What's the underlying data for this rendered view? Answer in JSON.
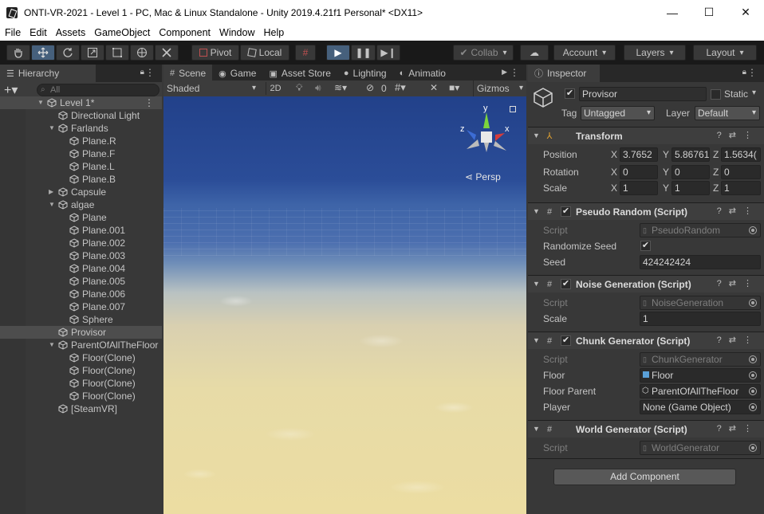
{
  "window": {
    "title": "ONTI-VR-2021 - Level 1 - PC, Mac & Linux Standalone - Unity 2019.4.21f1 Personal* <DX11>",
    "minimize": "—",
    "maximize": "☐",
    "close": "✕"
  },
  "menu": [
    "File",
    "Edit",
    "Assets",
    "GameObject",
    "Component",
    "Window",
    "Help"
  ],
  "toolbar": {
    "pivot": "Pivot",
    "local": "Local",
    "collab": "Collab",
    "account": "Account",
    "layers": "Layers",
    "layout": "Layout"
  },
  "hierarchy": {
    "tab": "Hierarchy",
    "search_placeholder": "All",
    "items": [
      {
        "label": "Level 1*",
        "depth": 0,
        "arrow": "▼",
        "type": "scene"
      },
      {
        "label": "Directional Light",
        "depth": 1,
        "arrow": "",
        "type": "object"
      },
      {
        "label": "Farlands",
        "depth": 1,
        "arrow": "▼",
        "type": "object"
      },
      {
        "label": "Plane.R",
        "depth": 2,
        "arrow": "",
        "type": "object"
      },
      {
        "label": "Plane.F",
        "depth": 2,
        "arrow": "",
        "type": "object"
      },
      {
        "label": "Plane.L",
        "depth": 2,
        "arrow": "",
        "type": "object"
      },
      {
        "label": "Plane.B",
        "depth": 2,
        "arrow": "",
        "type": "object"
      },
      {
        "label": "Capsule",
        "depth": 1,
        "arrow": "▶",
        "type": "object"
      },
      {
        "label": "algae",
        "depth": 1,
        "arrow": "▼",
        "type": "object"
      },
      {
        "label": "Plane",
        "depth": 2,
        "arrow": "",
        "type": "object"
      },
      {
        "label": "Plane.001",
        "depth": 2,
        "arrow": "",
        "type": "object"
      },
      {
        "label": "Plane.002",
        "depth": 2,
        "arrow": "",
        "type": "object"
      },
      {
        "label": "Plane.003",
        "depth": 2,
        "arrow": "",
        "type": "object"
      },
      {
        "label": "Plane.004",
        "depth": 2,
        "arrow": "",
        "type": "object"
      },
      {
        "label": "Plane.005",
        "depth": 2,
        "arrow": "",
        "type": "object"
      },
      {
        "label": "Plane.006",
        "depth": 2,
        "arrow": "",
        "type": "object"
      },
      {
        "label": "Plane.007",
        "depth": 2,
        "arrow": "",
        "type": "object"
      },
      {
        "label": "Sphere",
        "depth": 2,
        "arrow": "",
        "type": "object"
      },
      {
        "label": "Provisor",
        "depth": 1,
        "arrow": "",
        "type": "selected"
      },
      {
        "label": "ParentOfAllTheFloor",
        "depth": 1,
        "arrow": "▼",
        "type": "object"
      },
      {
        "label": "Floor(Clone)",
        "depth": 2,
        "arrow": "",
        "type": "object"
      },
      {
        "label": "Floor(Clone)",
        "depth": 2,
        "arrow": "",
        "type": "object"
      },
      {
        "label": "Floor(Clone)",
        "depth": 2,
        "arrow": "",
        "type": "object"
      },
      {
        "label": "Floor(Clone)",
        "depth": 2,
        "arrow": "",
        "type": "object"
      },
      {
        "label": "[SteamVR]",
        "depth": 1,
        "arrow": "",
        "type": "object"
      }
    ]
  },
  "scene_tabs": [
    {
      "label": "Scene",
      "icon": "#",
      "active": true
    },
    {
      "label": "Game",
      "icon": "◉",
      "active": false
    },
    {
      "label": "Asset Store",
      "icon": "▣",
      "active": false
    },
    {
      "label": "Lighting",
      "icon": "●",
      "active": false
    },
    {
      "label": "Animatio",
      "icon": "◐",
      "active": false
    }
  ],
  "scene_toolbar": {
    "shading": "Shaded",
    "mode_2d": "2D",
    "hidden_count": "0",
    "gizmos": "Gizmos"
  },
  "scene_view": {
    "persp_label": "Persp",
    "gizmo_axes": {
      "y": "y",
      "x": "x",
      "z": "z"
    }
  },
  "inspector": {
    "tab": "Inspector",
    "object_name": "Provisor",
    "static_label": "Static",
    "tag_label": "Tag",
    "tag_value": "Untagged",
    "layer_label": "Layer",
    "layer_value": "Default",
    "transform": {
      "title": "Transform",
      "position_label": "Position",
      "rotation_label": "Rotation",
      "scale_label": "Scale",
      "position": {
        "x": "3.7652",
        "y": "5.86761",
        "z": "1.5634("
      },
      "rotation": {
        "x": "0",
        "y": "0",
        "z": "0"
      },
      "scale": {
        "x": "1",
        "y": "1",
        "z": "1"
      }
    },
    "pseudo_random": {
      "title": "Pseudo Random (Script)",
      "script_label": "Script",
      "script_value": "PseudoRandom",
      "randomize_label": "Randomize Seed",
      "seed_label": "Seed",
      "seed_value": "424242424"
    },
    "noise_generation": {
      "title": "Noise Generation (Script)",
      "script_label": "Script",
      "script_value": "NoiseGeneration",
      "scale_label": "Scale",
      "scale_value": "1"
    },
    "chunk_generator": {
      "title": "Chunk Generator (Script)",
      "script_label": "Script",
      "script_value": "ChunkGenerator",
      "floor_label": "Floor",
      "floor_value": "Floor",
      "floor_parent_label": "Floor Parent",
      "floor_parent_value": "ParentOfAllTheFloor",
      "player_label": "Player",
      "player_value": "None (Game Object)"
    },
    "world_generator": {
      "title": "World Generator (Script)",
      "script_label": "Script",
      "script_value": "WorldGenerator"
    },
    "add_component": "Add Component"
  },
  "colors": {
    "accent": "#46607c",
    "panel": "#383838",
    "toolbar": "#191919"
  }
}
